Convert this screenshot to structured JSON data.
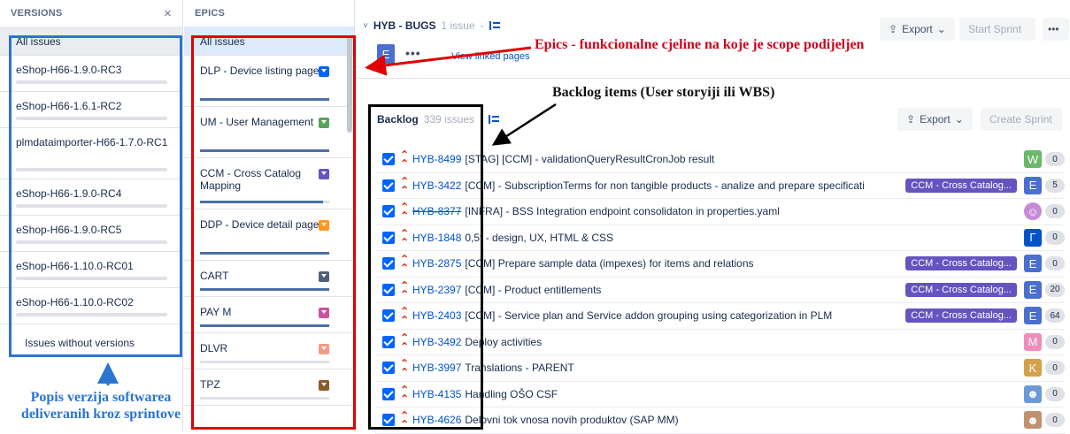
{
  "versions": {
    "header": "VERSIONS",
    "close_glyph": "×",
    "items": [
      {
        "label": "All issues",
        "selected": true
      },
      {
        "label": "eShop-H66-1.9.0-RC3"
      },
      {
        "label": "eShop-H66-1.6.1-RC2"
      },
      {
        "label": "plmdataimporter-H66-1.7.0-RC1"
      },
      {
        "label": "eShop-H66-1.9.0-RC4"
      },
      {
        "label": "eShop-H66-1.9.0-RC5"
      },
      {
        "label": "eShop-H66-1.10.0-RC01"
      },
      {
        "label": "eShop-H66-1.10.0-RC02"
      }
    ],
    "without_versions": "Issues without versions"
  },
  "epics": {
    "header": "EPICS",
    "items": [
      {
        "label": "All issues",
        "selected": true
      },
      {
        "label": "DLP - Device listing page",
        "color": "#0065ff",
        "progress": 1.0
      },
      {
        "label": "UM - User Management",
        "color": "#57a55a",
        "progress": 1.0
      },
      {
        "label": "CCM - Cross Catalog Mapping",
        "color": "#6554c0",
        "progress": 0.95
      },
      {
        "label": "DDP - Device detail page",
        "color": "#ff991f",
        "progress": 1.0
      },
      {
        "label": "CART",
        "color": "#505f79",
        "progress": 1.0
      },
      {
        "label": "PAY M",
        "color": "#cd519d",
        "progress": 1.0
      },
      {
        "label": "DLVR",
        "color": "#f79a83",
        "progress": 0.0
      },
      {
        "label": "TPZ",
        "color": "#8b5a2b",
        "progress": 0.0
      }
    ]
  },
  "sprint": {
    "chevron": "˅",
    "title": "HYB - BUGS",
    "count": "1 issue",
    "separator": "-",
    "export_label": "Export",
    "start_sprint_label": "Start Sprint",
    "more_glyph": "•••",
    "epic_avatar": "E",
    "view_linked_pages": "View linked pages"
  },
  "backlog": {
    "title": "Backlog",
    "count": "339 issues",
    "separator": "-",
    "export_label": "Export",
    "create_sprint_label": "Create Sprint",
    "rows": [
      {
        "key": "HYB-8499",
        "summary": "[STAG] [CCM] - validationQueryResultCronJob result",
        "epic": "",
        "avatar": "W",
        "avatar_color": "#6bb86b",
        "estimate": "0"
      },
      {
        "key": "HYB-3422",
        "summary": "[CCM] - SubscriptionTerms for non tangible products - analize and prepare specificati",
        "epic": "CCM - Cross Catalog...",
        "avatar": "E",
        "avatar_color": "#4a6fd0",
        "estimate": "5"
      },
      {
        "key": "HYB-8377",
        "summary": "[INFRA] - BSS Integration endpoint consolidaton in properties.yaml",
        "epic": "",
        "avatar": "☺",
        "avatar_color": "#c78bd6",
        "estimate": "0",
        "strike": true,
        "round": true
      },
      {
        "key": "HYB-1848",
        "summary": "0,5f - design, UX, HTML & CSS",
        "epic": "",
        "avatar": "Γ",
        "avatar_color": "#0052cc",
        "estimate": "0"
      },
      {
        "key": "HYB-2875",
        "summary": "[CCM] Prepare sample data (impexes) for items and relations",
        "epic": "CCM - Cross Catalog...",
        "avatar": "E",
        "avatar_color": "#4a6fd0",
        "estimate": "0"
      },
      {
        "key": "HYB-2397",
        "summary": "[CCM] - Product entitlements",
        "epic": "CCM - Cross Catalog...",
        "avatar": "E",
        "avatar_color": "#4a6fd0",
        "estimate": "20"
      },
      {
        "key": "HYB-2403",
        "summary": "[CCM] - Service plan and Service addon grouping using categorization in PLM",
        "epic": "CCM - Cross Catalog...",
        "avatar": "E",
        "avatar_color": "#4a6fd0",
        "estimate": "64"
      },
      {
        "key": "HYB-3492",
        "summary": "Deploy activities",
        "epic": "",
        "avatar": "M",
        "avatar_color": "#f08dbb",
        "estimate": "0"
      },
      {
        "key": "HYB-3997",
        "summary": "Translations - PARENT",
        "epic": "",
        "avatar": "K",
        "avatar_color": "#d4a14a",
        "estimate": "0"
      },
      {
        "key": "HYB-4135",
        "summary": "Handling OŠO CSF",
        "epic": "",
        "avatar": "☻",
        "avatar_color": "#6a9bd8",
        "estimate": "0"
      },
      {
        "key": "HYB-4626",
        "summary": "Delovni tok vnosa novih produktov (SAP MM)",
        "epic": "",
        "avatar": "☻",
        "avatar_color": "#c09070",
        "estimate": "0"
      }
    ]
  },
  "annotations": {
    "epics_note": "Epics - funkcionalne cjeline na koje je scope podijeljen",
    "backlog_note": "Backlog items (User storyiji ili WBS)",
    "versions_note_line1": "Popis verzija softwarea",
    "versions_note_line2": "deliveranih kroz sprintove",
    "red": "#e00000",
    "black": "#000000",
    "blue": "#2a74d2"
  },
  "icons": {
    "export": "share-export-icon",
    "priority": "double-chevron-up-icon",
    "check": "checkbox-checked-icon"
  }
}
